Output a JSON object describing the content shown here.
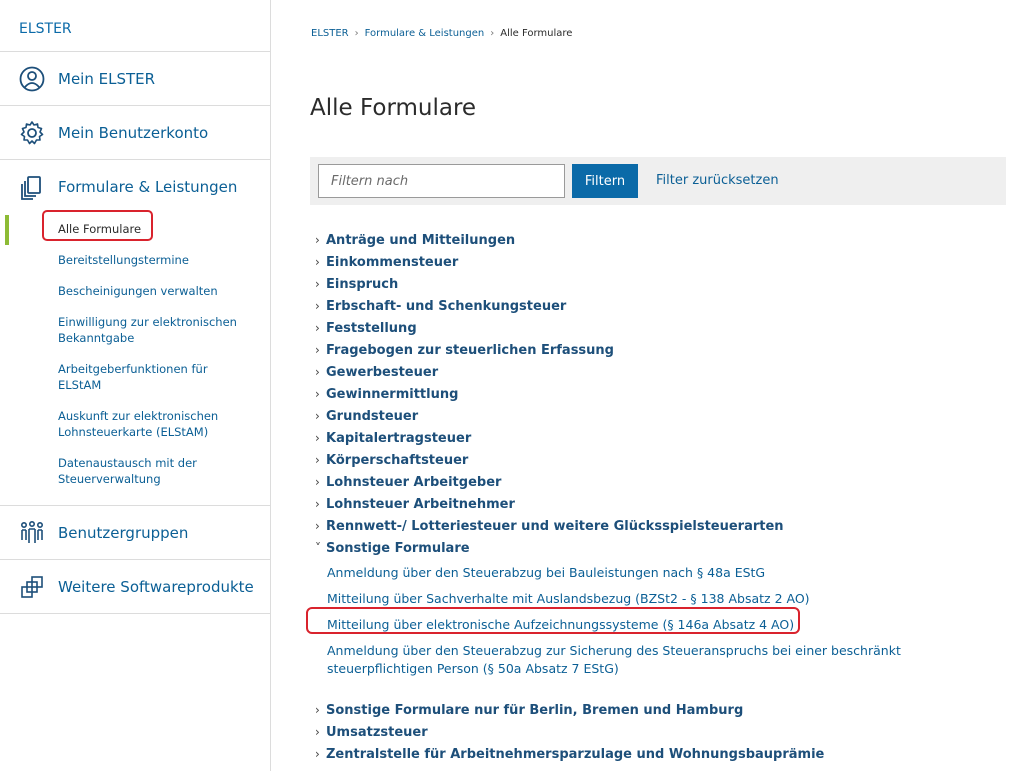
{
  "sidebar": {
    "brand": "ELSTER",
    "main_items": [
      {
        "label": "Mein ELSTER",
        "icon": "user-circle-icon"
      },
      {
        "label": "Mein Benutzerkonto",
        "icon": "gear-icon"
      },
      {
        "label": "Formulare & Leistungen",
        "icon": "documents-icon"
      }
    ],
    "sub_items": [
      {
        "label": "Alle Formulare",
        "active": true
      },
      {
        "label": "Bereitstellungstermine"
      },
      {
        "label": "Bescheinigungen verwalten"
      },
      {
        "label": "Einwilligung zur elektronischen Bekanntgabe"
      },
      {
        "label": "Arbeitgeberfunktionen für ELStAM"
      },
      {
        "label": "Auskunft zur elektronischen Lohnsteuerkarte (ELStAM)"
      },
      {
        "label": "Datenaustausch mit der Steuerverwaltung"
      }
    ],
    "bottom_items": [
      {
        "label": "Benutzergruppen",
        "icon": "users-group-icon"
      },
      {
        "label": "Weitere Softwareprodukte",
        "icon": "software-icon"
      }
    ]
  },
  "breadcrumb": [
    "ELSTER",
    "Formulare & Leistungen",
    "Alle Formulare"
  ],
  "page_title": "Alle Formulare",
  "filter": {
    "placeholder": "Filtern nach",
    "button_label": "Filtern",
    "reset_label": "Filter zurücksetzen"
  },
  "categories_before": [
    "Anträge und Mitteilungen",
    "Einkommensteuer",
    "Einspruch",
    "Erbschaft- und Schenkungsteuer",
    "Feststellung",
    "Fragebogen zur steuerlichen Erfassung",
    "Gewerbesteuer",
    "Gewinnermittlung",
    "Grundsteuer",
    "Kapitalertragsteuer",
    "Körperschaftsteuer",
    "Lohnsteuer Arbeitgeber",
    "Lohnsteuer Arbeitnehmer",
    "Rennwett-/ Lotteriesteuer und weitere Glücksspielsteuerarten"
  ],
  "expanded_category": {
    "label": "Sonstige Formulare",
    "links": [
      "Anmeldung über den Steuerabzug bei Bauleistungen nach § 48a EStG",
      "Mitteilung über Sachverhalte mit Auslandsbezug (BZSt2 - § 138 Absatz 2 AO)",
      "Mitteilung über elektronische Aufzeichnungssysteme (§ 146a Absatz 4 AO)",
      "Anmeldung über den Steuerabzug zur Sicherung des Steueranspruchs bei einer beschränkt steuerpflichtigen Person (§ 50a Absatz 7 EStG)"
    ]
  },
  "categories_after": [
    "Sonstige Formulare nur für Berlin, Bremen und Hamburg",
    "Umsatzsteuer",
    "Zentralstelle für Arbeitnehmersparzulage und Wohnungsbauprämie"
  ],
  "colors": {
    "accent": "#0b6aa8",
    "active_bar": "#8dbb35",
    "highlight": "#d9232d"
  }
}
